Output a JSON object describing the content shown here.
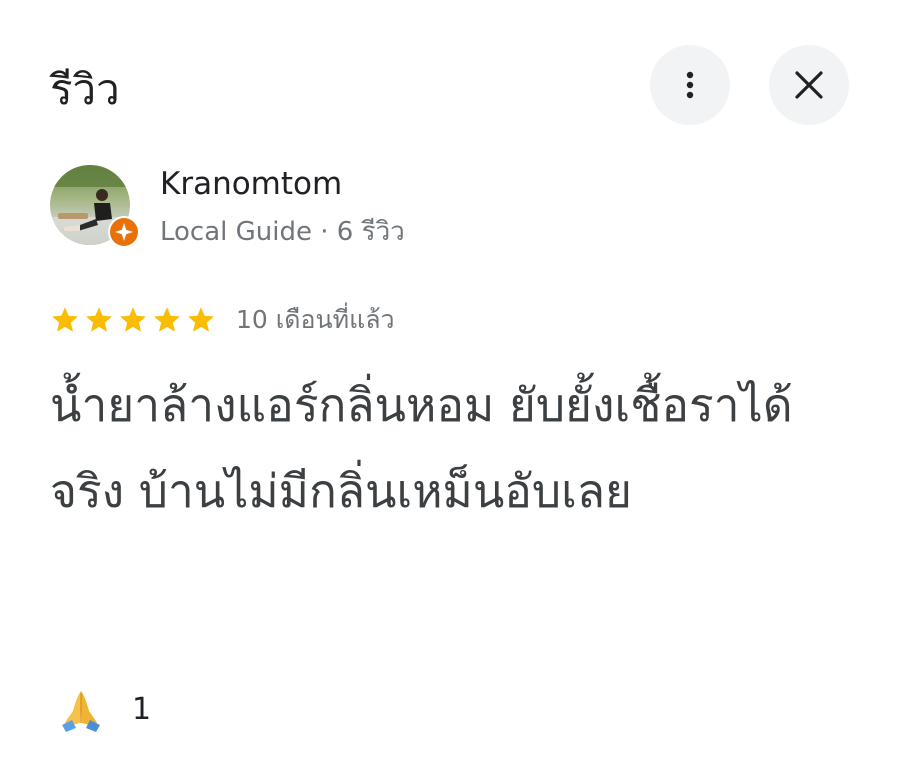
{
  "header": {
    "title": "รีวิว",
    "more_icon": "more-vert-icon",
    "close_icon": "close-icon",
    "button_bg": "#f1f3f4"
  },
  "author": {
    "name": "Kranomtom",
    "meta": "Local Guide · 6 รีวิว",
    "badge_icon": "local-guide-badge-icon",
    "badge_color": "#e8710a"
  },
  "rating": {
    "stars": 5,
    "max_stars": 5,
    "star_color": "#fbbc04",
    "date": "10 เดือนที่แล้ว"
  },
  "review": {
    "text": "น้ำยาล้างแอร์กลิ่นหอม ยับยั้งเชื้อราได้จริง บ้านไม่มีกลิ่นเหม็นอับเลย"
  },
  "reactions": [
    {
      "icon": "folded-hands-icon",
      "count": "1"
    }
  ]
}
